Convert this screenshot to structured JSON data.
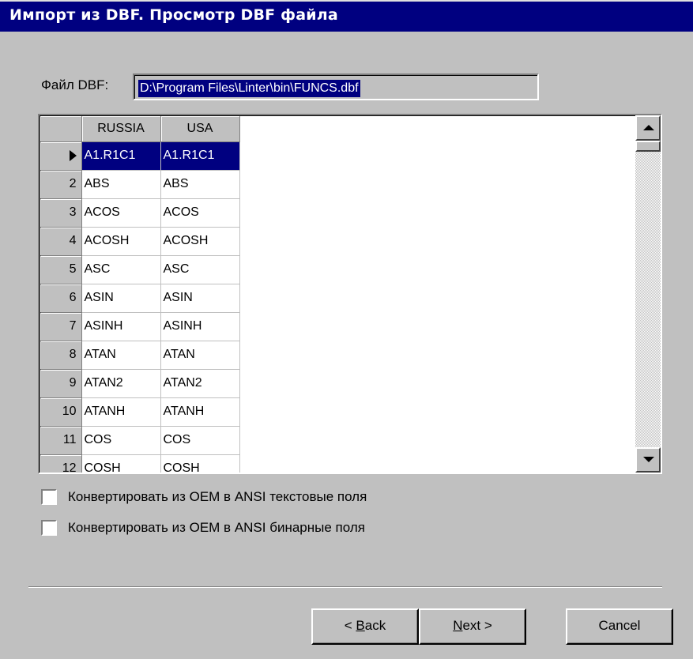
{
  "window": {
    "title": "Импорт из DBF. Просмотр DBF файла"
  },
  "file": {
    "label": "Файл DBF:",
    "value": "D:\\Program Files\\Linter\\bin\\FUNCS.dbf"
  },
  "grid": {
    "columns": [
      "RUSSIA",
      "USA"
    ],
    "rows": [
      {
        "index": "",
        "russia": "A1.R1C1",
        "usa": "A1.R1C1"
      },
      {
        "index": "2",
        "russia": "ABS",
        "usa": "ABS"
      },
      {
        "index": "3",
        "russia": "ACOS",
        "usa": "ACOS"
      },
      {
        "index": "4",
        "russia": "ACOSH",
        "usa": "ACOSH"
      },
      {
        "index": "5",
        "russia": "ASC",
        "usa": "ASC"
      },
      {
        "index": "6",
        "russia": "ASIN",
        "usa": "ASIN"
      },
      {
        "index": "7",
        "russia": "ASINH",
        "usa": "ASINH"
      },
      {
        "index": "8",
        "russia": "ATAN",
        "usa": "ATAN"
      },
      {
        "index": "9",
        "russia": "ATAN2",
        "usa": "ATAN2"
      },
      {
        "index": "10",
        "russia": "ATANH",
        "usa": "ATANH"
      },
      {
        "index": "11",
        "russia": "COS",
        "usa": "COS"
      },
      {
        "index": "12",
        "russia": "COSH",
        "usa": "COSH"
      }
    ]
  },
  "options": {
    "convert_text": {
      "label": "Конвертировать из OEM в ANSI текстовые поля",
      "checked": false
    },
    "convert_binary": {
      "label": "Конвертировать из OEM в ANSI бинарные поля",
      "checked": false
    }
  },
  "buttons": {
    "back_prefix": "< ",
    "back_mnemonic": "B",
    "back_rest": "ack",
    "next_mnemonic": "N",
    "next_rest": "ext >",
    "cancel": "Cancel"
  },
  "colors": {
    "title_bar": "#000080",
    "selection": "#000080",
    "face": "#c0c0c0"
  }
}
